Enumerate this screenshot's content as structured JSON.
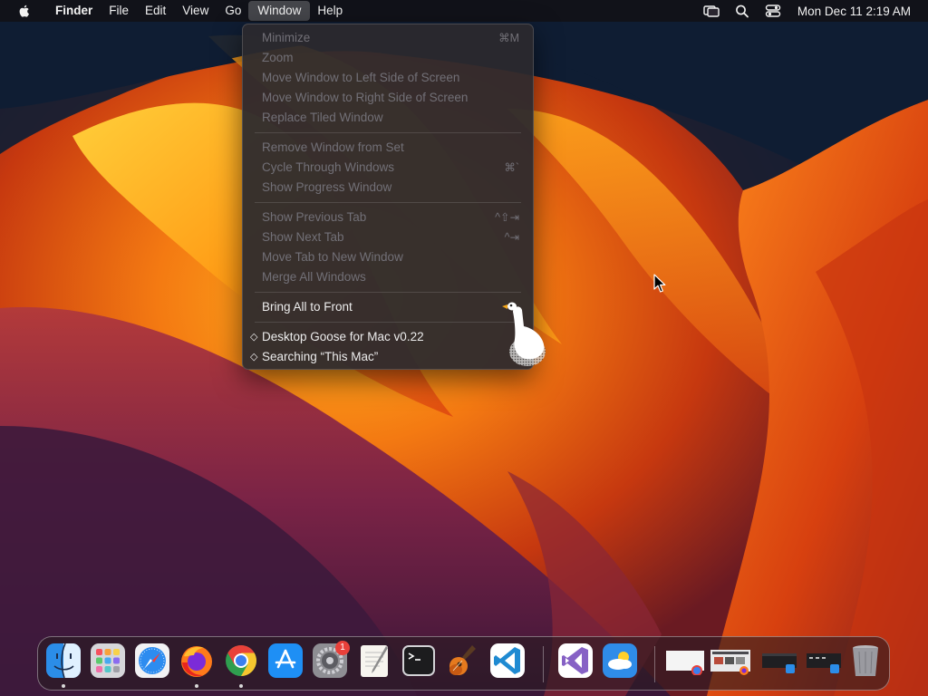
{
  "menubar": {
    "app_name": "Finder",
    "menus": [
      "File",
      "Edit",
      "View",
      "Go",
      "Window",
      "Help"
    ],
    "clock": "Mon Dec 11  2:19 AM"
  },
  "window_menu": {
    "groups": [
      [
        {
          "label": "Minimize",
          "shortcut": "⌘M",
          "enabled": false
        },
        {
          "label": "Zoom",
          "shortcut": "",
          "enabled": false
        },
        {
          "label": "Move Window to Left Side of Screen",
          "shortcut": "",
          "enabled": false
        },
        {
          "label": "Move Window to Right Side of Screen",
          "shortcut": "",
          "enabled": false
        },
        {
          "label": "Replace Tiled Window",
          "shortcut": "",
          "enabled": false
        }
      ],
      [
        {
          "label": "Remove Window from Set",
          "shortcut": "",
          "enabled": false
        },
        {
          "label": "Cycle Through Windows",
          "shortcut": "⌘`",
          "enabled": false
        },
        {
          "label": "Show Progress Window",
          "shortcut": "",
          "enabled": false
        }
      ],
      [
        {
          "label": "Show Previous Tab",
          "shortcut": "^⇧⇥",
          "enabled": false
        },
        {
          "label": "Show Next Tab",
          "shortcut": "^⇥",
          "enabled": false
        },
        {
          "label": "Move Tab to New Window",
          "shortcut": "",
          "enabled": false
        },
        {
          "label": "Merge All Windows",
          "shortcut": "",
          "enabled": false
        }
      ],
      [
        {
          "label": "Bring All to Front",
          "shortcut": "",
          "enabled": true
        }
      ],
      [
        {
          "label": "Desktop Goose for Mac v0.22",
          "shortcut": "",
          "enabled": true,
          "marker": "◇"
        },
        {
          "label": "Searching “This Mac”",
          "shortcut": "",
          "enabled": true,
          "marker": "◇"
        }
      ]
    ]
  },
  "dock": {
    "apps": [
      {
        "name": "finder",
        "running": true
      },
      {
        "name": "launchpad",
        "running": false
      },
      {
        "name": "safari",
        "running": false
      },
      {
        "name": "firefox",
        "running": true
      },
      {
        "name": "chrome",
        "running": true
      },
      {
        "name": "app-store",
        "running": false
      },
      {
        "name": "system-settings",
        "running": false,
        "badge": "1"
      },
      {
        "name": "textedit",
        "running": false
      },
      {
        "name": "terminal",
        "running": false
      },
      {
        "name": "garageband",
        "running": false
      },
      {
        "name": "vscode",
        "running": false
      }
    ],
    "recent_apps": [
      {
        "name": "visual-studio"
      },
      {
        "name": "weather"
      }
    ],
    "minimized_windows": [
      {
        "name": "chrome-window"
      },
      {
        "name": "firefox-window"
      },
      {
        "name": "finder-window-1"
      },
      {
        "name": "finder-window-2"
      }
    ],
    "trash": {
      "name": "trash"
    }
  },
  "colors": {
    "menubar_bg": "#121014",
    "menu_bg": "#2c292e",
    "disabled_text": "#727077",
    "enabled_text": "#ececec",
    "badge": "#e8403a"
  }
}
